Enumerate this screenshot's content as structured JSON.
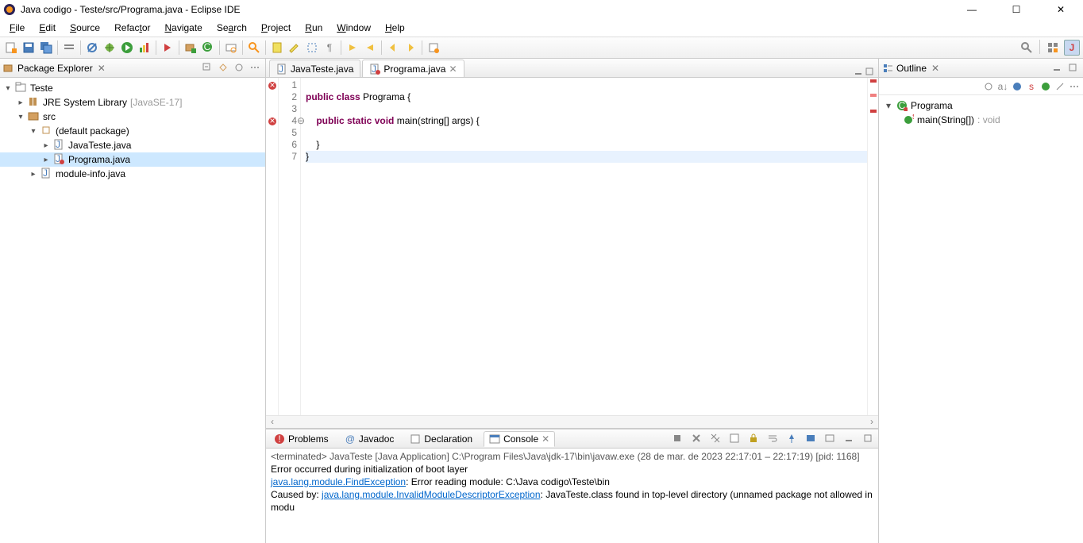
{
  "window": {
    "title": "Java codigo - Teste/src/Programa.java - Eclipse IDE"
  },
  "menu": [
    "File",
    "Edit",
    "Source",
    "Refactor",
    "Navigate",
    "Search",
    "Project",
    "Run",
    "Window",
    "Help"
  ],
  "package_explorer": {
    "title": "Package Explorer",
    "project": "Teste",
    "jre": "JRE System Library",
    "jre_detail": "[JavaSE-17]",
    "src": "src",
    "pkg": "(default package)",
    "file1": "JavaTeste.java",
    "file2": "Programa.java",
    "file3": "module-info.java"
  },
  "editor": {
    "tab1": "JavaTeste.java",
    "tab2": "Programa.java",
    "lines": [
      "1",
      "2",
      "3",
      "4",
      "5",
      "6",
      "7"
    ],
    "code": {
      "l1": "",
      "l2_a": "public",
      "l2_b": " class",
      "l2_c": " Programa {",
      "l3": "",
      "l4_a": "    public",
      "l4_b": " static",
      "l4_c": " void",
      "l4_d": " main(string[] args) {",
      "l5": "",
      "l6": "    }",
      "l7": "}"
    }
  },
  "bottom": {
    "tab_problems": "Problems",
    "tab_javadoc": "Javadoc",
    "tab_declaration": "Declaration",
    "tab_console": "Console",
    "console_title": "<terminated> JavaTeste [Java Application] C:\\Program Files\\Java\\jdk-17\\bin\\javaw.exe (28 de mar. de 2023 22:17:01 – 22:17:19) [pid: 1168]",
    "console_l1": "Error occurred during initialization of boot layer",
    "console_l2a": "java.lang.module.FindException",
    "console_l2b": ": Error reading module: C:\\Java codigo\\Teste\\bin",
    "console_l3a": "Caused by: ",
    "console_l3b": "java.lang.module.InvalidModuleDescriptorException",
    "console_l3c": ": JavaTeste.class found in top-level directory (unnamed package not allowed in modu"
  },
  "outline": {
    "title": "Outline",
    "class": "Programa",
    "method": "main(String[])",
    "method_ret": " : void"
  }
}
